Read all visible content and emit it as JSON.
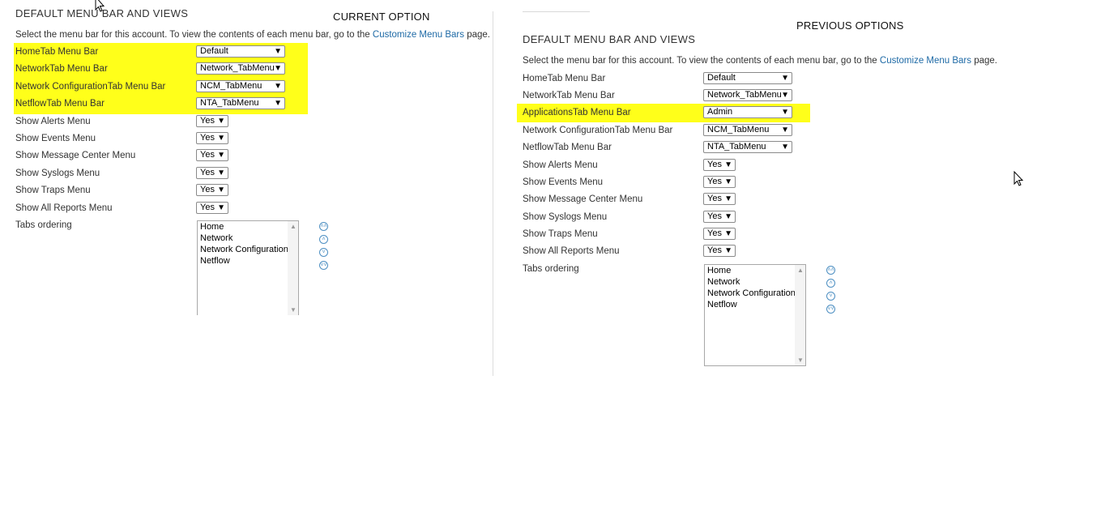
{
  "left": {
    "heading": "CURRENT OPTION",
    "section_title": "DEFAULT MENU BAR AND VIEWS",
    "desc_prefix": "Select the menu bar for this account. To view the contents of each menu bar, go to the ",
    "desc_link": "Customize Menu Bars",
    "desc_suffix": " page.",
    "menubars": [
      {
        "label": "HomeTab Menu Bar",
        "value": "Default"
      },
      {
        "label": "NetworkTab Menu Bar",
        "value": "Network_TabMenu"
      },
      {
        "label": "Network ConfigurationTab Menu Bar",
        "value": "NCM_TabMenu"
      },
      {
        "label": "NetflowTab Menu Bar",
        "value": "NTA_TabMenu"
      }
    ],
    "shows": [
      {
        "label": "Show Alerts Menu",
        "value": "Yes"
      },
      {
        "label": "Show Events Menu",
        "value": "Yes"
      },
      {
        "label": "Show Message Center Menu",
        "value": "Yes"
      },
      {
        "label": "Show Syslogs Menu",
        "value": "Yes"
      },
      {
        "label": "Show Traps Menu",
        "value": "Yes"
      },
      {
        "label": "Show All Reports Menu",
        "value": "Yes"
      }
    ],
    "tabs_label": "Tabs ordering",
    "tabs": [
      "Home",
      "Network",
      "Network Configuration",
      "Netflow"
    ]
  },
  "right": {
    "heading": "PREVIOUS OPTIONS",
    "section_title": "DEFAULT MENU BAR AND VIEWS",
    "desc_prefix": "Select the menu bar for this account. To view the contents of each menu bar, go to the ",
    "desc_link": "Customize Menu Bars",
    "desc_suffix": " page.",
    "menubars": [
      {
        "label": "HomeTab Menu Bar",
        "value": "Default"
      },
      {
        "label": "NetworkTab Menu Bar",
        "value": "Network_TabMenu"
      },
      {
        "label": "ApplicationsTab Menu Bar",
        "value": "Admin"
      },
      {
        "label": "Network ConfigurationTab Menu Bar",
        "value": "NCM_TabMenu"
      },
      {
        "label": "NetflowTab Menu Bar",
        "value": "NTA_TabMenu"
      }
    ],
    "shows": [
      {
        "label": "Show Alerts Menu",
        "value": "Yes"
      },
      {
        "label": "Show Events Menu",
        "value": "Yes"
      },
      {
        "label": "Show Message Center Menu",
        "value": "Yes"
      },
      {
        "label": "Show Syslogs Menu",
        "value": "Yes"
      },
      {
        "label": "Show Traps Menu",
        "value": "Yes"
      },
      {
        "label": "Show All Reports Menu",
        "value": "Yes"
      }
    ],
    "tabs_label": "Tabs ordering",
    "tabs": [
      "Home",
      "Network",
      "Network Configuration",
      "Netflow"
    ]
  },
  "colors": {
    "highlight": "#ffff1a",
    "link": "#1e6aa6",
    "icon": "#4d8fc2"
  },
  "icons": {
    "move_top": "double-chevron-up-icon",
    "move_up": "chevron-up-icon",
    "move_down": "chevron-down-icon",
    "move_bottom": "double-chevron-down-icon"
  }
}
